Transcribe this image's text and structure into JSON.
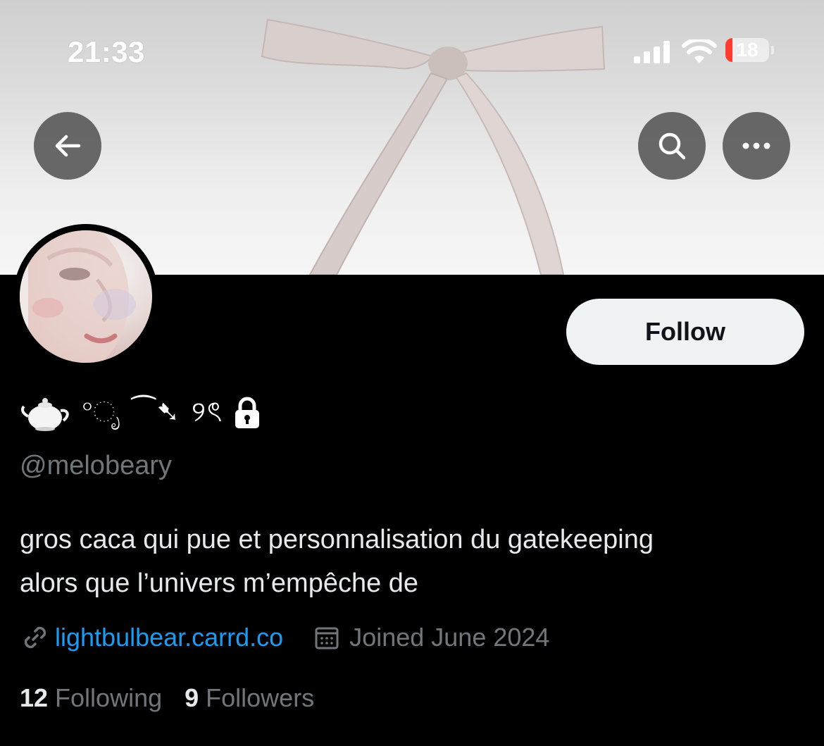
{
  "status_bar": {
    "time": "21:33",
    "battery": "18"
  },
  "header": {
    "back_icon": "arrow-left-icon",
    "search_icon": "search-icon",
    "more_icon": "ellipsis-icon"
  },
  "profile": {
    "display_name_decoration": "°ೃ ⁀➷ ୨ৎ",
    "handle": "@melobeary",
    "follow_label": "Follow",
    "bio_line1": "gros caca qui pue et personnalisation du gatekeeping",
    "bio_line2": "alors que l’univers m’empêche de",
    "website": "lightbulbear.carrd.co",
    "joined": "Joined June 2024",
    "following_count": "12",
    "following_label": "Following",
    "followers_count": "9",
    "followers_label": "Followers"
  },
  "colors": {
    "accent_link": "#1d9bf0",
    "muted": "#71767b",
    "battery_low": "#ff3b30"
  }
}
